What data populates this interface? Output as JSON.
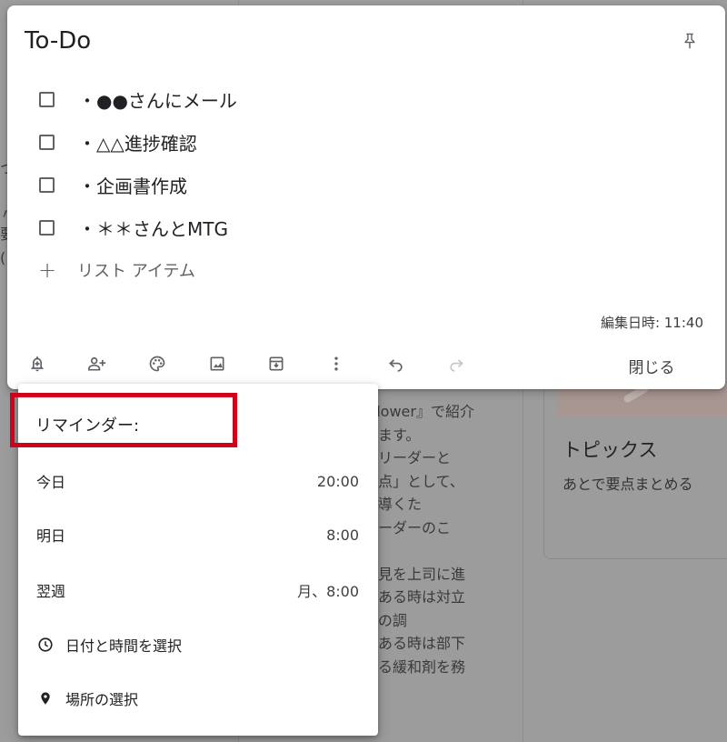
{
  "note": {
    "title": "To-Do",
    "items": [
      {
        "text": "・●●さんにメール",
        "checked": false
      },
      {
        "text": "・△△進捗確認",
        "checked": false
      },
      {
        "text": "・企画書作成",
        "checked": false
      },
      {
        "text": "・＊＊さんとMTG",
        "checked": false
      }
    ],
    "add_item_placeholder": "リスト アイテム",
    "edited_label": "編集日時: 11:40",
    "close_label": "閉じる",
    "toolbar_icons": [
      "bell-plus-icon",
      "person-add-icon",
      "palette-icon",
      "image-icon",
      "archive-icon",
      "more-vert-icon",
      "undo-icon",
      "redo-icon"
    ]
  },
  "reminder_menu": {
    "header": "リマインダー:",
    "options": [
      {
        "label": "今日",
        "time": "20:00"
      },
      {
        "label": "明日",
        "time": "8:00"
      },
      {
        "label": "翌週",
        "time": "月、8:00"
      }
    ],
    "pick_date_time_label": "日付と時間を選択",
    "pick_place_label": "場所の選択"
  },
  "background": {
    "note_lines": [
      "ollower』で紹介",
      "ります。",
      "・リーダーと",
      "節点」として、",
      "に導くた",
      "リーダーのこ",
      "",
      "意見を上司に進",
      "、ある時は対立",
      "との調",
      "たある時は部下",
      "ける緩和剤を務"
    ],
    "card_title": "トピックス",
    "card_text": "あとで要点まとめる"
  },
  "colors": {
    "highlight": "#d0021b",
    "backdrop": "#9c9c9c",
    "icon": "#5f6368"
  }
}
